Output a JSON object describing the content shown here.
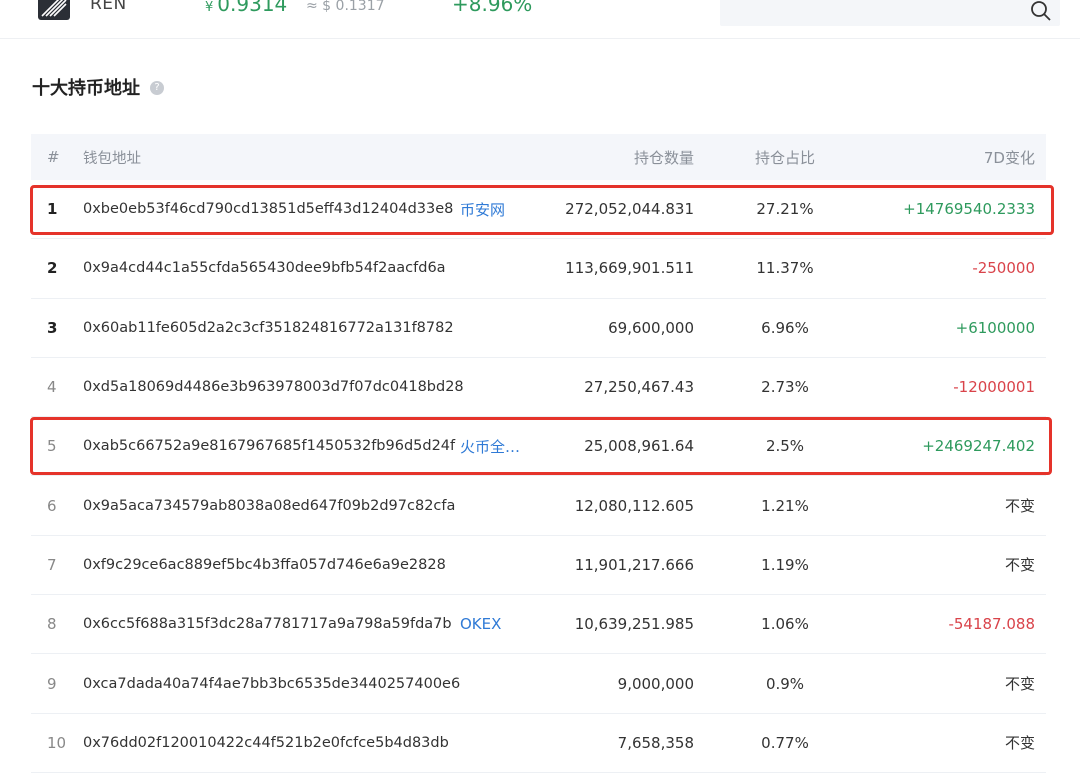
{
  "coin": {
    "name": "REN",
    "price_currency": "¥",
    "price": "0.9314",
    "usd": "≈ $ 0.1317",
    "change": "+8.96%"
  },
  "search": {
    "placeholder": ""
  },
  "section": {
    "title": "十大持币地址",
    "help": "?"
  },
  "table": {
    "headers": {
      "rank": "#",
      "address": "钱包地址",
      "quantity": "持仓数量",
      "percent": "持仓占比",
      "change": "7D变化"
    },
    "rows": [
      {
        "rank": "1",
        "address": "0xbe0eb53f46cd790cd13851d5eff43d12404d33e8",
        "tag": "币安网",
        "quantity": "272,052,044.831",
        "percent": "27.21%",
        "change": "+14769540.2333",
        "trend": "pos"
      },
      {
        "rank": "2",
        "address": "0x9a4cd44c1a55cfda565430dee9bfb54f2aacfd6a",
        "tag": "",
        "quantity": "113,669,901.511",
        "percent": "11.37%",
        "change": "-250000",
        "trend": "neg"
      },
      {
        "rank": "3",
        "address": "0x60ab11fe605d2a2c3cf351824816772a131f8782",
        "tag": "",
        "quantity": "69,600,000",
        "percent": "6.96%",
        "change": "+6100000",
        "trend": "pos"
      },
      {
        "rank": "4",
        "address": "0xd5a18069d4486e3b963978003d7f07dc0418bd28",
        "tag": "",
        "quantity": "27,250,467.43",
        "percent": "2.73%",
        "change": "-12000001",
        "trend": "neg"
      },
      {
        "rank": "5",
        "address": "0xab5c66752a9e8167967685f1450532fb96d5d24f",
        "tag": "火币全…",
        "quantity": "25,008,961.64",
        "percent": "2.5%",
        "change": "+2469247.402",
        "trend": "pos"
      },
      {
        "rank": "6",
        "address": "0x9a5aca734579ab8038a08ed647f09b2d97c82cfa",
        "tag": "",
        "quantity": "12,080,112.605",
        "percent": "1.21%",
        "change": "不变",
        "trend": "flat"
      },
      {
        "rank": "7",
        "address": "0xf9c29ce6ac889ef5bc4b3ffa057d746e6a9e2828",
        "tag": "",
        "quantity": "11,901,217.666",
        "percent": "1.19%",
        "change": "不变",
        "trend": "flat"
      },
      {
        "rank": "8",
        "address": "0x6cc5f688a315f3dc28a7781717a9a798a59fda7b",
        "tag": "OKEX",
        "quantity": "10,639,251.985",
        "percent": "1.06%",
        "change": "-54187.088",
        "trend": "neg"
      },
      {
        "rank": "9",
        "address": "0xca7dada40a74f4ae7bb3bc6535de3440257400e6",
        "tag": "",
        "quantity": "9,000,000",
        "percent": "0.9%",
        "change": "不变",
        "trend": "flat"
      },
      {
        "rank": "10",
        "address": "0x76dd02f120010422c44f521b2e0fcfce5b4d83db",
        "tag": "",
        "quantity": "7,658,358",
        "percent": "0.77%",
        "change": "不变",
        "trend": "flat"
      }
    ]
  },
  "colors": {
    "positive": "#2e9a5d",
    "negative": "#d9434a",
    "tag_link": "#2f7ad6",
    "highlight": "#e5332a"
  }
}
